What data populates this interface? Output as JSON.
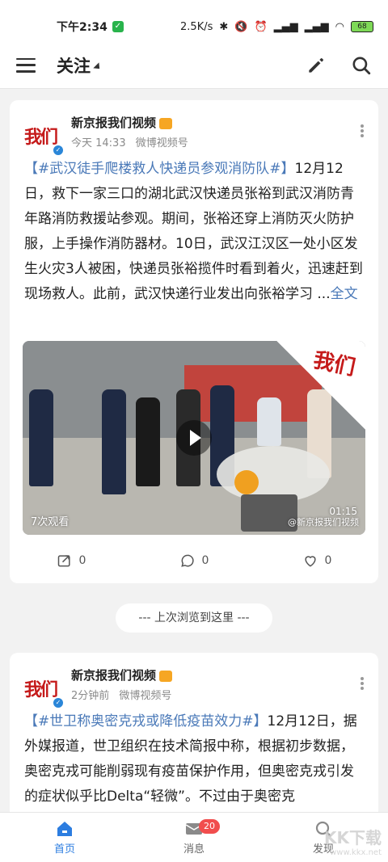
{
  "status_bar": {
    "time": "下午2:34",
    "speed": "2.5K/s",
    "battery": "68"
  },
  "header": {
    "title": "关注"
  },
  "posts": [
    {
      "author": "新京报我们视频",
      "logo_text": "我们",
      "time": "今天 14:33",
      "source": "微博视频号",
      "tag": "【#武汉徒手爬楼救人快递员参观消防队#】",
      "text": "12月12日，救下一家三口的湖北武汉快递员张裕到武汉消防青年路消防救援站参观。期间，张裕还穿上消防灭火防护服，上手操作消防器材。10日，武汉江汉区一处小区发生火灾3人被困，快递员张裕揽件时看到着火，迅速赶到现场救人。此前，武汉快递行业发出向张裕学习",
      "ellipsis": " ...",
      "more_link": "全文",
      "video": {
        "views": "7次观看",
        "duration": "01:15",
        "watermark": "@新京报我们视频",
        "corner_mark": "我们"
      },
      "reposts": "0",
      "comments": "0",
      "likes": "0"
    },
    {
      "author": "新京报我们视频",
      "logo_text": "我们",
      "time": "2分钟前",
      "source": "微博视频号",
      "tag": "【#世卫称奥密克戎或降低疫苗效力#】",
      "text": "12月12日，据外媒报道，世卫组织在技术简报中称，根据初步数据，奥密克戎可能削弱现有疫苗保护作用，但奥密克戎引发的症状似乎比Delta“轻微”。不过由于奥密克"
    }
  ],
  "divider": "--- 上次浏览到这里 ---",
  "tabs": [
    {
      "label": "首页",
      "icon": "home-icon",
      "active": true
    },
    {
      "label": "消息",
      "icon": "mail-icon",
      "badge": "20"
    },
    {
      "label": "发现",
      "icon": "discover-icon"
    }
  ],
  "watermark": {
    "text": "KK下载",
    "url": "www.kkx.net"
  },
  "colors": {
    "accent": "#2c7de0",
    "link": "#4a79b8",
    "badge": "#f14d4d",
    "brand_red": "#c51a1a"
  }
}
